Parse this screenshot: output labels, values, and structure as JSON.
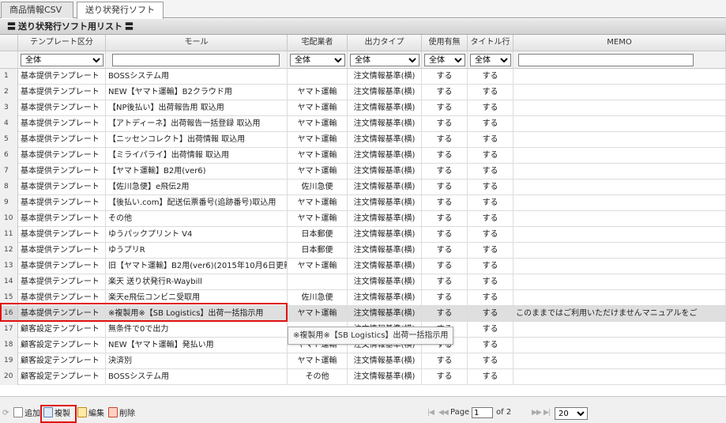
{
  "tabs": [
    {
      "label": "商品情報CSV",
      "active": false
    },
    {
      "label": "送り状発行ソフト",
      "active": true
    }
  ],
  "panel": {
    "eq_left": "〓",
    "title": "送り状発行ソフト用リスト",
    "eq_right": "〓"
  },
  "columns": [
    "テンプレート区分",
    "モール",
    "宅配業者",
    "出力タイプ",
    "使用有無",
    "タイトル行",
    "MEMO"
  ],
  "filters": {
    "template": "全体",
    "mall": "",
    "carrier": "全体",
    "output": "全体",
    "use": "全体",
    "title": "全体",
    "memo": ""
  },
  "rows": [
    {
      "n": "1",
      "tpl": "基本提供テンプレート",
      "mall": "BOSSシステム用",
      "carrier": "",
      "output": "注文情報基準(横)",
      "use": "する",
      "title": "する",
      "memo": ""
    },
    {
      "n": "2",
      "tpl": "基本提供テンプレート",
      "mall": "NEW【ヤマト運輸】B2クラウド用",
      "carrier": "ヤマト運輸",
      "output": "注文情報基準(横)",
      "use": "する",
      "title": "する",
      "memo": ""
    },
    {
      "n": "3",
      "tpl": "基本提供テンプレート",
      "mall": "【NP後払い】出荷報告用 取込用",
      "carrier": "ヤマト運輸",
      "output": "注文情報基準(横)",
      "use": "する",
      "title": "する",
      "memo": ""
    },
    {
      "n": "4",
      "tpl": "基本提供テンプレート",
      "mall": "【アトディーネ】出荷報告一括登録 取込用",
      "carrier": "ヤマト運輸",
      "output": "注文情報基準(横)",
      "use": "する",
      "title": "する",
      "memo": ""
    },
    {
      "n": "5",
      "tpl": "基本提供テンプレート",
      "mall": "【ニッセンコレクト】出荷情報 取込用",
      "carrier": "ヤマト運輸",
      "output": "注文情報基準(横)",
      "use": "する",
      "title": "する",
      "memo": ""
    },
    {
      "n": "6",
      "tpl": "基本提供テンプレート",
      "mall": "【ミライパライ】出荷情報 取込用",
      "carrier": "ヤマト運輸",
      "output": "注文情報基準(横)",
      "use": "する",
      "title": "する",
      "memo": ""
    },
    {
      "n": "7",
      "tpl": "基本提供テンプレート",
      "mall": "【ヤマト運輸】B2用(ver6)",
      "carrier": "ヤマト運輸",
      "output": "注文情報基準(横)",
      "use": "する",
      "title": "する",
      "memo": ""
    },
    {
      "n": "8",
      "tpl": "基本提供テンプレート",
      "mall": "【佐川急便】e飛伝2用",
      "carrier": "佐川急便",
      "output": "注文情報基準(横)",
      "use": "する",
      "title": "する",
      "memo": ""
    },
    {
      "n": "9",
      "tpl": "基本提供テンプレート",
      "mall": "【後払い.com】配送伝票番号(追跡番号)取込用",
      "carrier": "ヤマト運輸",
      "output": "注文情報基準(横)",
      "use": "する",
      "title": "する",
      "memo": ""
    },
    {
      "n": "10",
      "tpl": "基本提供テンプレート",
      "mall": "その他",
      "carrier": "ヤマト運輸",
      "output": "注文情報基準(横)",
      "use": "する",
      "title": "する",
      "memo": ""
    },
    {
      "n": "11",
      "tpl": "基本提供テンプレート",
      "mall": "ゆうパックプリント V4",
      "carrier": "日本郵便",
      "output": "注文情報基準(横)",
      "use": "する",
      "title": "する",
      "memo": ""
    },
    {
      "n": "12",
      "tpl": "基本提供テンプレート",
      "mall": "ゆうプリR",
      "carrier": "日本郵便",
      "output": "注文情報基準(横)",
      "use": "する",
      "title": "する",
      "memo": ""
    },
    {
      "n": "13",
      "tpl": "基本提供テンプレート",
      "mall": "旧【ヤマト運輸】B2用(ver6)(2015年10月6日更新",
      "carrier": "ヤマト運輸",
      "output": "注文情報基準(横)",
      "use": "する",
      "title": "する",
      "memo": ""
    },
    {
      "n": "14",
      "tpl": "基本提供テンプレート",
      "mall": "楽天 送り状発行R-Waybill",
      "carrier": "",
      "output": "注文情報基準(横)",
      "use": "する",
      "title": "する",
      "memo": ""
    },
    {
      "n": "15",
      "tpl": "基本提供テンプレート",
      "mall": "楽天e飛伝コンビニ受取用",
      "carrier": "佐川急便",
      "output": "注文情報基準(横)",
      "use": "する",
      "title": "する",
      "memo": ""
    },
    {
      "n": "16",
      "tpl": "基本提供テンプレート",
      "mall": "※複製用※【SB Logistics】出荷一括指示用",
      "carrier": "ヤマト運輸",
      "output": "注文情報基準(横)",
      "use": "する",
      "title": "する",
      "memo": "このままではご利用いただけませんマニュアルをご"
    },
    {
      "n": "17",
      "tpl": "顧客設定テンプレート",
      "mall": "無条件で0で出力",
      "carrier": "",
      "output": "注文情報基準(横)",
      "use": "する",
      "title": "する",
      "memo": ""
    },
    {
      "n": "18",
      "tpl": "顧客設定テンプレート",
      "mall": "NEW【ヤマト運輸】発払い用",
      "carrier": "ヤマト運輸",
      "output": "注文情報基準(横)",
      "use": "する",
      "title": "する",
      "memo": ""
    },
    {
      "n": "19",
      "tpl": "顧客設定テンプレート",
      "mall": "決済別",
      "carrier": "ヤマト運輸",
      "output": "注文情報基準(横)",
      "use": "する",
      "title": "する",
      "memo": ""
    },
    {
      "n": "20",
      "tpl": "顧客設定テンプレート",
      "mall": "BOSSシステム用",
      "carrier": "その他",
      "output": "注文情報基準(横)",
      "use": "する",
      "title": "する",
      "memo": ""
    }
  ],
  "selected_row": "16",
  "tooltip": "※複製用※【SB Logistics】出荷一括指示用",
  "toolbar": {
    "refresh": "⟳",
    "add": "追加",
    "duplicate": "複製",
    "edit": "編集",
    "delete": "削除"
  },
  "pager": {
    "first": "|◀",
    "prev": "◀◀",
    "page_label": "Page",
    "page_value": "1",
    "of_label": "of 2",
    "next": "▶▶",
    "last": "▶|",
    "page_size": "20",
    "page_size_options": [
      "20"
    ]
  },
  "colors": {
    "highlight_border": "#e01010",
    "selected_row": "#dfdfdf"
  }
}
